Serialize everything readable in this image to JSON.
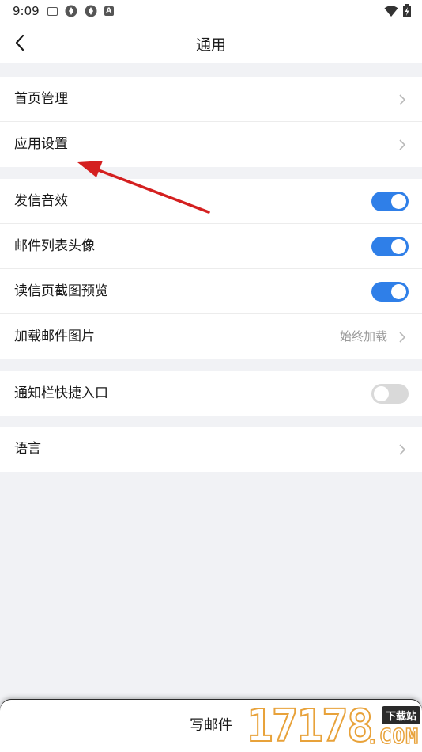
{
  "status_bar": {
    "time": "9:09",
    "icons": [
      "mail-icon",
      "app-icon",
      "app-icon",
      "a-icon"
    ],
    "right_icons": [
      "wifi-icon",
      "battery-icon"
    ]
  },
  "nav": {
    "title": "通用",
    "back_icon": "chevron-left-icon"
  },
  "groups": [
    {
      "items": [
        {
          "label": "首页管理",
          "control": "chevron"
        },
        {
          "label": "应用设置",
          "control": "chevron"
        }
      ]
    },
    {
      "items": [
        {
          "label": "发信音效",
          "control": "toggle",
          "on": true
        },
        {
          "label": "邮件列表头像",
          "control": "toggle",
          "on": true
        },
        {
          "label": "读信页截图预览",
          "control": "toggle",
          "on": true
        },
        {
          "label": "加载邮件图片",
          "control": "chevron",
          "value": "始终加载"
        }
      ]
    },
    {
      "items": [
        {
          "label": "通知栏快捷入口",
          "control": "toggle",
          "on": false
        }
      ]
    },
    {
      "items": [
        {
          "label": "语言",
          "control": "chevron"
        }
      ]
    }
  ],
  "bottom_bar": {
    "compose_label": "写邮件"
  },
  "watermark": {
    "number": "17178",
    "badge": "下载站",
    "suffix": ".COM"
  },
  "colors": {
    "accent": "#2f7fe8",
    "toggle_off": "#d9d9d9",
    "background": "#f1f2f5",
    "annotation_arrow": "#d42020"
  }
}
